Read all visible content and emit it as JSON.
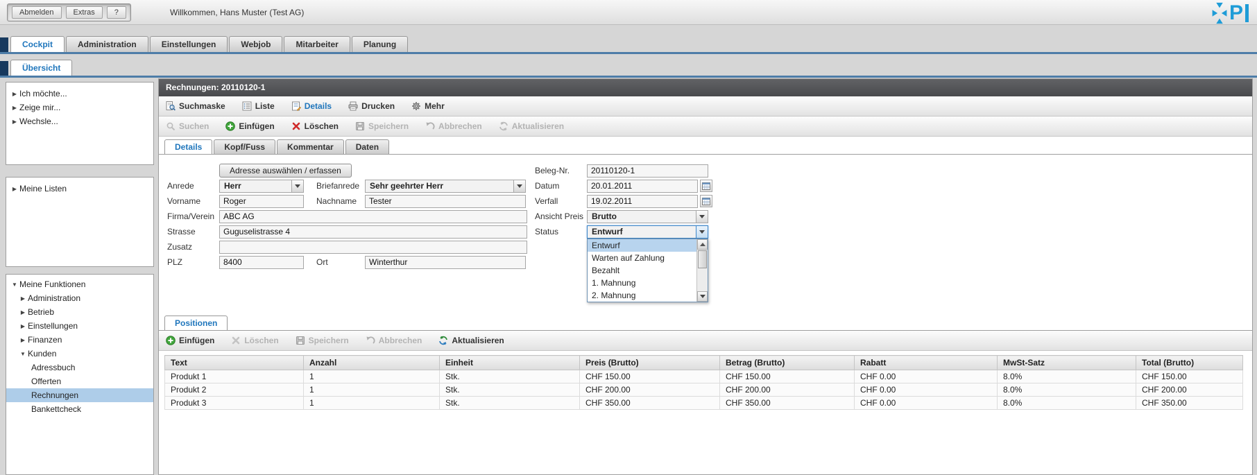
{
  "colors": {
    "accent_blue": "#1f76bc",
    "selection_blue": "#b8d4ee",
    "logo_blue": "#1e9cd7"
  },
  "topbar": {
    "menu": [
      "Abmelden",
      "Extras",
      "?"
    ],
    "welcome": "Willkommen, Hans Muster (Test AG)",
    "logo_letter": "P"
  },
  "tabs": {
    "main": [
      "Cockpit",
      "Administration",
      "Einstellungen",
      "Webjob",
      "Mitarbeiter",
      "Planung"
    ],
    "sub": "Übersicht"
  },
  "sidebar": {
    "quick": [
      {
        "arrow": "▶",
        "label": "Ich möchte..."
      },
      {
        "arrow": "▶",
        "label": "Zeige mir..."
      },
      {
        "arrow": "▶",
        "label": "Wechsle..."
      }
    ],
    "lists": {
      "arrow": "▶",
      "label": "Meine Listen"
    },
    "functions": [
      {
        "arrow": "▼",
        "label": "Meine Funktionen"
      },
      {
        "arrow": "▶",
        "label": "Administration"
      },
      {
        "arrow": "▶",
        "label": "Betrieb"
      },
      {
        "arrow": "▶",
        "label": "Einstellungen"
      },
      {
        "arrow": "▶",
        "label": "Finanzen"
      },
      {
        "arrow": "▼",
        "label": "Kunden"
      },
      {
        "arrow": "",
        "label": "Adressbuch"
      },
      {
        "arrow": "",
        "label": "Offerten"
      },
      {
        "arrow": "",
        "label": "Rechnungen"
      },
      {
        "arrow": "",
        "label": "Bankettcheck"
      }
    ]
  },
  "panel": {
    "title": "Rechnungen: 20110120-1",
    "viewbar": {
      "suchmaske": "Suchmaske",
      "liste": "Liste",
      "details": "Details",
      "drucken": "Drucken",
      "mehr": "Mehr"
    },
    "actionbar": {
      "suchen": "Suchen",
      "einfuegen": "Einfügen",
      "loeschen": "Löschen",
      "speichern": "Speichern",
      "abbrechen": "Abbrechen",
      "aktualisieren": "Aktualisieren"
    },
    "detail_tabs": [
      "Details",
      "Kopf/Fuss",
      "Kommentar",
      "Daten"
    ]
  },
  "form": {
    "address_button": "Adresse auswählen / erfassen",
    "anrede": {
      "label": "Anrede",
      "value": "Herr"
    },
    "briefanrede": {
      "label": "Briefanrede",
      "value": "Sehr geehrter Herr"
    },
    "vorname": {
      "label": "Vorname",
      "value": "Roger"
    },
    "nachname": {
      "label": "Nachname",
      "value": "Tester"
    },
    "firma": {
      "label": "Firma/Verein",
      "value": "ABC AG"
    },
    "strasse": {
      "label": "Strasse",
      "value": "Guguselistrasse 4"
    },
    "zusatz": {
      "label": "Zusatz",
      "value": ""
    },
    "plz": {
      "label": "PLZ",
      "value": "8400"
    },
    "ort": {
      "label": "Ort",
      "value": "Winterthur"
    },
    "beleg": {
      "label": "Beleg-Nr.",
      "value": "20110120-1"
    },
    "datum": {
      "label": "Datum",
      "value": "20.01.2011"
    },
    "verfall": {
      "label": "Verfall",
      "value": "19.02.2011"
    },
    "ansicht": {
      "label": "Ansicht Preis",
      "value": "Brutto"
    },
    "status": {
      "label": "Status",
      "value": "Entwurf"
    },
    "status_options": [
      "Entwurf",
      "Warten auf Zahlung",
      "Bezahlt",
      "1. Mahnung",
      "2. Mahnung"
    ]
  },
  "positions": {
    "tab": "Positionen",
    "toolbar": {
      "einfuegen": "Einfügen",
      "loeschen": "Löschen",
      "speichern": "Speichern",
      "abbrechen": "Abbrechen",
      "aktualisieren": "Aktualisieren"
    },
    "table": {
      "headers": [
        "Text",
        "Anzahl",
        "Einheit",
        "Preis (Brutto)",
        "Betrag (Brutto)",
        "Rabatt",
        "MwSt-Satz",
        "Total (Brutto)"
      ],
      "rows": [
        [
          "Produkt 1",
          "1",
          "Stk.",
          "CHF 150.00",
          "CHF 150.00",
          "CHF 0.00",
          "8.0%",
          "CHF 150.00"
        ],
        [
          "Produkt 2",
          "1",
          "Stk.",
          "CHF 200.00",
          "CHF 200.00",
          "CHF 0.00",
          "8.0%",
          "CHF 200.00"
        ],
        [
          "Produkt 3",
          "1",
          "Stk.",
          "CHF 350.00",
          "CHF 350.00",
          "CHF 0.00",
          "8.0%",
          "CHF 350.00"
        ]
      ]
    }
  }
}
